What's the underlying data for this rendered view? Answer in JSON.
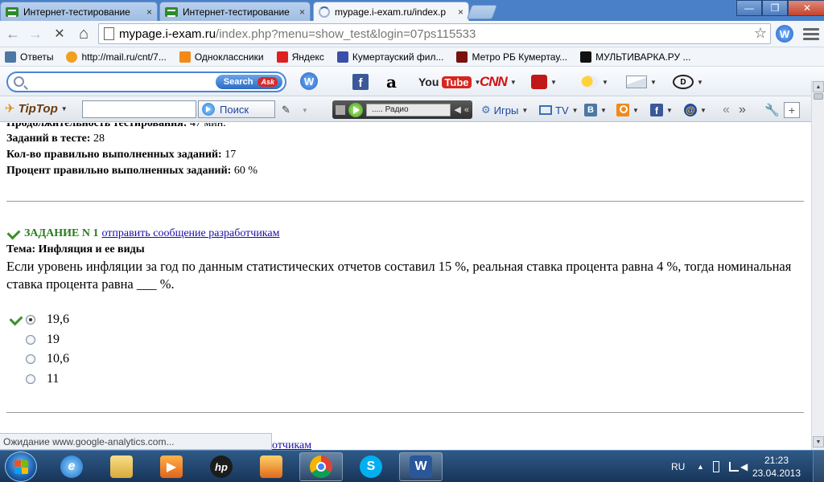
{
  "tabs": [
    {
      "title": "Интернет-тестирование",
      "close": "×",
      "state": "inactive"
    },
    {
      "title": "Интернет-тестирование",
      "close": "×",
      "state": "inactive"
    },
    {
      "title": "mypage.i-exam.ru/index.p",
      "close": "×",
      "state": "active"
    }
  ],
  "window_controls": {
    "minimize": "—",
    "maximize": "❐",
    "close": "✕"
  },
  "nav": {
    "back": "←",
    "forward": "→",
    "stop": "✕",
    "home": "⌂",
    "url_host": "mypage.i-exam.ru",
    "url_path": "/index.php?menu=show_test&login=07ps115533",
    "star": "☆"
  },
  "bookmarks": [
    {
      "label": "Ответы",
      "icon": "vk-icon",
      "color": "#4d77a5"
    },
    {
      "label": "http://mail.ru/cnt/7...",
      "icon": "mail-icon",
      "color": "#f0a020"
    },
    {
      "label": "Одноклассники",
      "icon": "ok-icon",
      "color": "#f28a1a"
    },
    {
      "label": "Яндекс",
      "icon": "yandex-icon",
      "color": "#e02020"
    },
    {
      "label": "Кумертауский фил...",
      "icon": "university-icon",
      "color": "#3a4fa8"
    },
    {
      "label": "Метро РБ Кумертау...",
      "icon": "metro-icon",
      "color": "#7a1010"
    },
    {
      "label": "МУЛЬТИВАРКА.РУ ...",
      "icon": "multivarka-icon",
      "color": "#111111"
    }
  ],
  "toolbar1": {
    "search_button": "Search",
    "ask_badge": "Ask",
    "youtube_you": "You",
    "youtube_tube": "Tube",
    "cnn": "CNN",
    "amazon": "a"
  },
  "toolbar2": {
    "brand": "TipTop",
    "search_button": "Поиск",
    "radio_station": "..... Радио",
    "games": "Игры",
    "tv": "TV",
    "vk": "B"
  },
  "content": {
    "duration_line_label": "Продолжительность тестирования:",
    "duration_line_value": "47 мин.",
    "tasks_label": "Заданий в тесте:",
    "tasks_value": "28",
    "correct_label": "Кол-во правильно выполненных заданий:",
    "correct_value": "17",
    "percent_label": "Процент правильно выполненных заданий:",
    "percent_value": "60 %",
    "task_title": "ЗАДАНИЕ N 1",
    "dev_link": "отправить сообщение разработчикам",
    "topic_label": "Тема:",
    "topic_value": "Инфляция и ее виды",
    "question": "Если уровень инфляции за год по данным статистических отчетов составил 15 %, реальная ставка процента равна 4 %, тогда номинальная ставка процента равна ___ %.",
    "options": [
      {
        "label": "19,6",
        "selected": true,
        "correct": true
      },
      {
        "label": "19",
        "selected": false,
        "correct": false
      },
      {
        "label": "10,6",
        "selected": false,
        "correct": false
      },
      {
        "label": "11",
        "selected": false,
        "correct": false
      }
    ],
    "next_link_partial": "отчикам"
  },
  "status": "Ожидание www.google-analytics.com...",
  "taskbar": {
    "lang": "RU",
    "time": "21:23",
    "date": "23.04.2013",
    "apps": [
      {
        "name": "internet-explorer-icon",
        "active": false
      },
      {
        "name": "file-explorer-icon",
        "active": false
      },
      {
        "name": "media-player-icon",
        "active": false
      },
      {
        "name": "hp-icon",
        "active": false
      },
      {
        "name": "installer-icon",
        "active": false
      },
      {
        "name": "chrome-icon",
        "active": true
      },
      {
        "name": "skype-icon",
        "active": false
      },
      {
        "name": "word-icon",
        "active": true
      }
    ]
  }
}
